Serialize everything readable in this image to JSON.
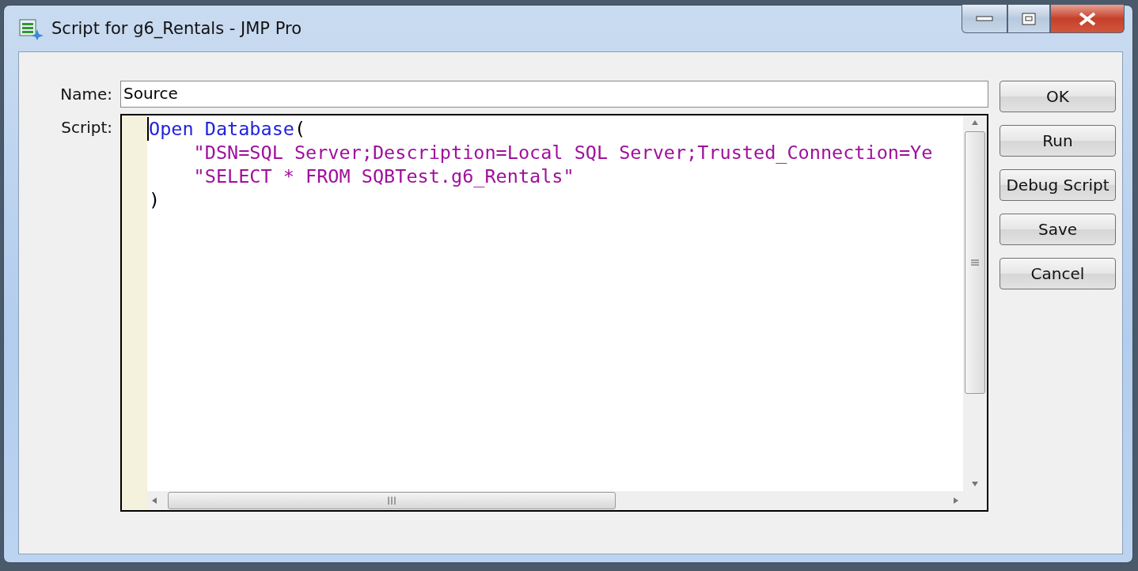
{
  "window": {
    "title": "Script for g6_Rentals - JMP Pro"
  },
  "name_field": {
    "label": "Name:",
    "value": "Source"
  },
  "script_field": {
    "label": "Script:",
    "lines": [
      {
        "tokens": [
          {
            "kind": "keyword",
            "text": "Open Database"
          },
          {
            "kind": "punct",
            "text": "("
          }
        ]
      },
      {
        "tokens": [
          {
            "kind": "string",
            "text": "    \"DSN=SQL Server;Description=Local SQL Server;Trusted_Connection=Ye"
          }
        ]
      },
      {
        "tokens": [
          {
            "kind": "string",
            "text": "    \"SELECT * FROM SQBTest.g6_Rentals\""
          }
        ]
      },
      {
        "tokens": [
          {
            "kind": "punct",
            "text": ")"
          }
        ]
      }
    ]
  },
  "buttons": [
    "OK",
    "Run",
    "Debug Script",
    "Save",
    "Cancel"
  ]
}
